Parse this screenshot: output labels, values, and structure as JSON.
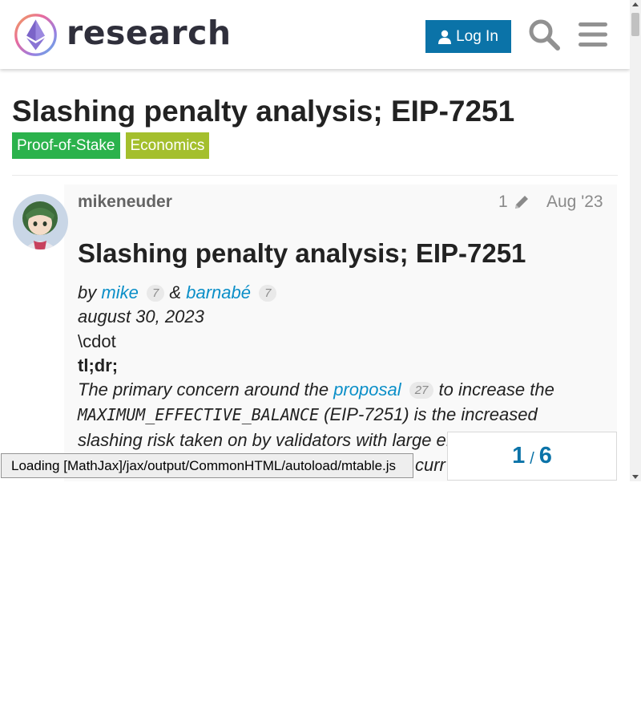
{
  "site": {
    "name": "research",
    "accent": "#0b73a8"
  },
  "header": {
    "login_label": "Log In",
    "search_icon": "search-icon",
    "menu_icon": "hamburger-menu-icon"
  },
  "topic": {
    "title": "Slashing penalty analysis; EIP-7251",
    "tags": [
      {
        "label": "Proof-of-Stake",
        "color": "#2bb24c"
      },
      {
        "label": "Economics",
        "color": "#a4bf2d"
      }
    ]
  },
  "post": {
    "username": "mikeneuder",
    "edit_count": "1",
    "date": "Aug '23",
    "heading": "Slashing penalty analysis; EIP-7251",
    "by": "by",
    "author1": "mike",
    "author1_count": "7",
    "amp": "&",
    "author2": "barnabé",
    "author2_count": "7",
    "date_line": "august 30, 2023",
    "cdot_line": "\\cdot",
    "tldr": "tl;dr;",
    "para_start": "The primary concern around the",
    "proposal_link": "proposal",
    "proposal_count": "27",
    "para_mid": "to increase the",
    "code": "MAXIMUM_EFFECTIVE_BALANCE",
    "para_mid2": "(EIP-7251) is the increased",
    "para_line3": "slashing risk taken on by validators with large ef",
    "para_line4_tail": "curr"
  },
  "loading": {
    "text": "Loading [MathJax]/jax/output/CommonHTML/autoload/mtable.js"
  },
  "progress": {
    "current": "1",
    "separator": "/",
    "total": "6"
  }
}
